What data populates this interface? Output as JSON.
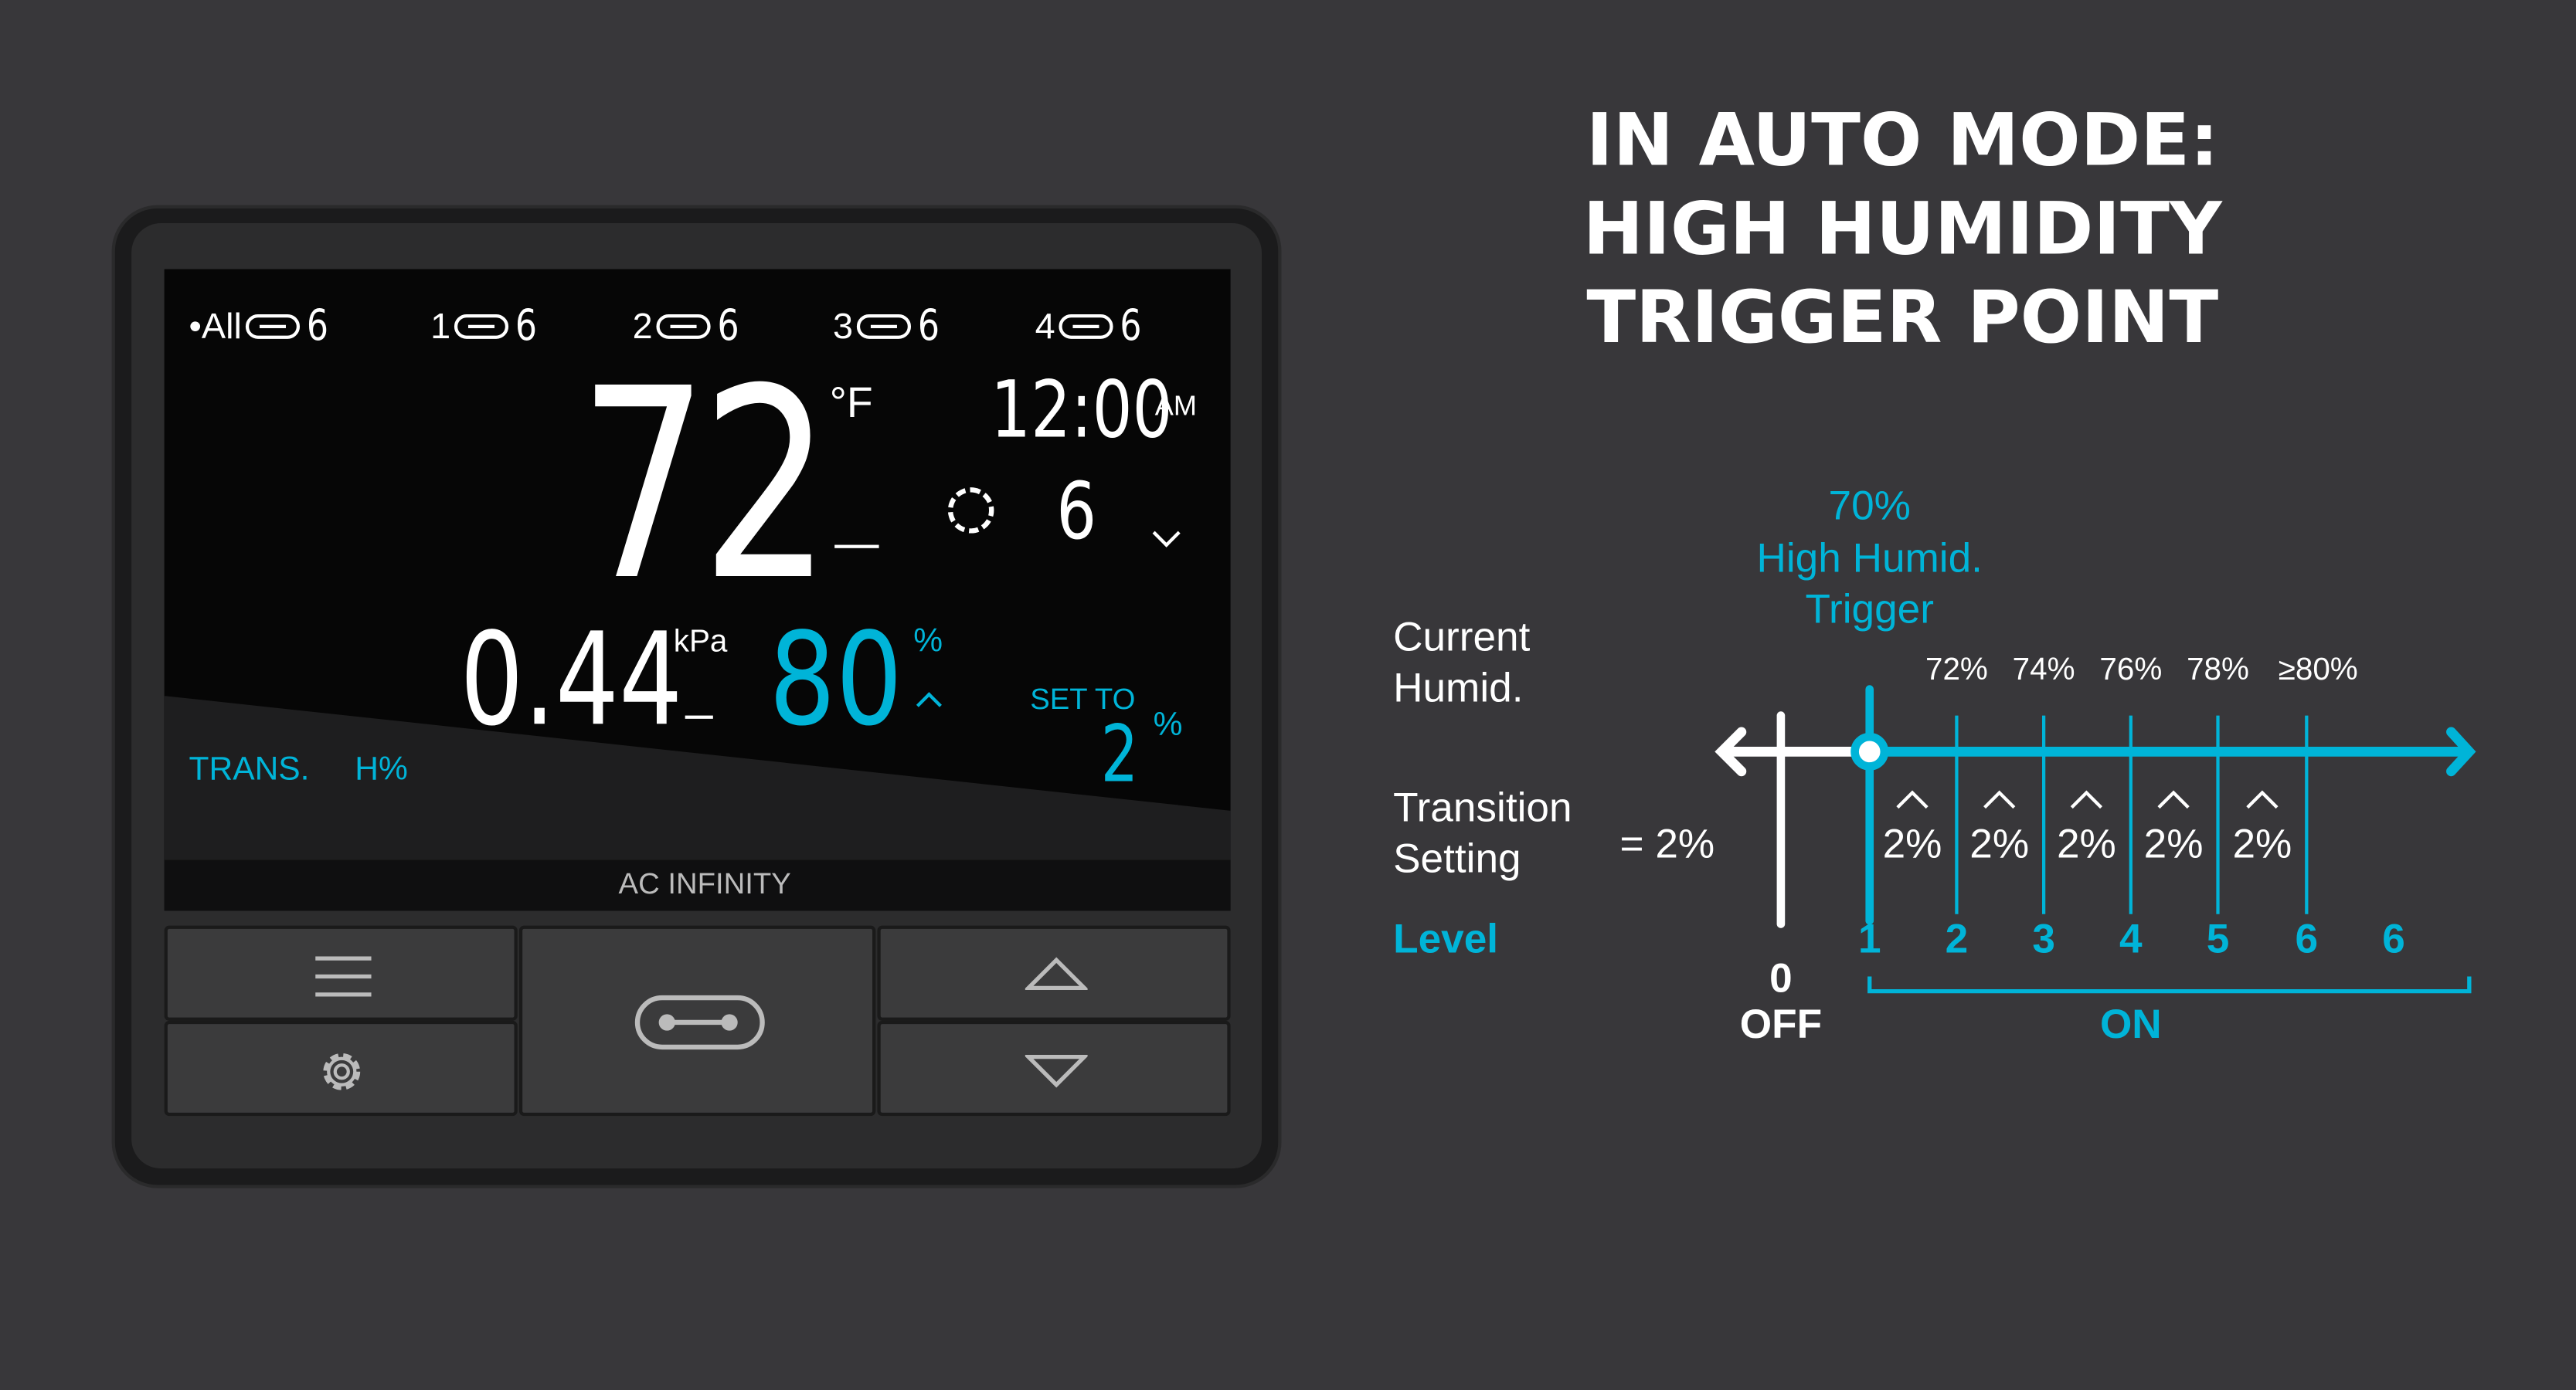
{
  "device": {
    "brand": "AC INFINITY",
    "ports": [
      {
        "label": "•All",
        "level": "6"
      },
      {
        "label": "1",
        "level": "6"
      },
      {
        "label": "2",
        "level": "6"
      },
      {
        "label": "3",
        "level": "6"
      },
      {
        "label": "4",
        "level": "6"
      }
    ],
    "temperature": "72",
    "temp_unit": "°F",
    "time": "12:00",
    "ampm": "AM",
    "fan_level": "6",
    "vpd": "0.44",
    "vpd_unit": "kPa",
    "humidity": "80",
    "humidity_unit": "%",
    "set_to_label": "SET TO",
    "set_to_value": "2",
    "set_to_unit": "%",
    "mode_label": "TRANS.",
    "mode_sub": "H%",
    "buttons": [
      "menu-icon",
      "gear-icon",
      "fan-icon",
      "up-icon",
      "down-icon"
    ]
  },
  "title": [
    "IN AUTO MODE:",
    "HIGH HUMIDITY",
    "TRIGGER POINT"
  ],
  "diagram": {
    "trigger_value": "70%",
    "trigger_label_1": "High Humid.",
    "trigger_label_2": "Trigger",
    "current_label_1": "Current",
    "current_label_2": "Humid.",
    "thresholds": [
      "72%",
      "74%",
      "76%",
      "78%",
      "≥80%"
    ],
    "transition_label_1": "Transition",
    "transition_label_2": "Setting",
    "transition_value": "= 2%",
    "steps": [
      "2%",
      "2%",
      "2%",
      "2%",
      "2%"
    ],
    "level_label": "Level",
    "levels": [
      "1",
      "2",
      "3",
      "4",
      "5",
      "6",
      "6"
    ],
    "off_level": "0",
    "off_label": "OFF",
    "on_label": "ON"
  },
  "colors": {
    "accent": "#00b4d8",
    "background": "#38373a"
  }
}
